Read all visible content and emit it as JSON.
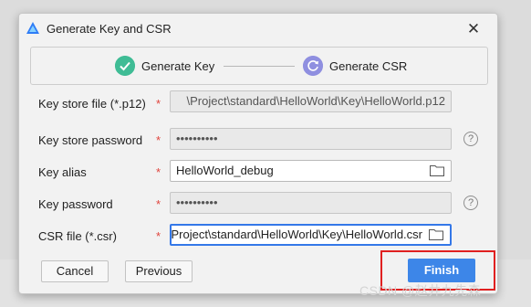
{
  "dialog": {
    "title": "Generate Key and CSR",
    "close_glyph": "✕",
    "steps": [
      {
        "label": "Generate Key",
        "state": "done",
        "icon": "check-icon"
      },
      {
        "label": "Generate CSR",
        "state": "current",
        "icon": "progress-icon"
      }
    ],
    "fields": {
      "key_store_file": {
        "label": "Key store file (*.p12)",
        "value": "\\Project\\standard\\HelloWorld\\Key\\HelloWorld.p12",
        "enabled": false
      },
      "key_store_password": {
        "label": "Key store password",
        "value": "••••••••••",
        "enabled": false
      },
      "key_alias": {
        "label": "Key alias",
        "value": "HelloWorld_debug",
        "enabled": true
      },
      "key_password": {
        "label": "Key password",
        "value": "••••••••••",
        "enabled": false
      },
      "csr_file": {
        "label": "CSR file (*.csr)",
        "value": "\\Project\\standard\\HelloWorld\\Key\\HelloWorld.csr",
        "enabled": true,
        "focused": true
      }
    },
    "required_mark": "*",
    "help_glyph": "?",
    "buttons": {
      "cancel": "Cancel",
      "previous": "Previous",
      "finish": "Finish"
    }
  },
  "watermark": "CSDN @赵井九先森",
  "colors": {
    "accent": "#3d86e8",
    "step_done": "#3fbc95",
    "step_current": "#8f8fe0",
    "required": "#e0443d",
    "highlight": "#e02020"
  }
}
